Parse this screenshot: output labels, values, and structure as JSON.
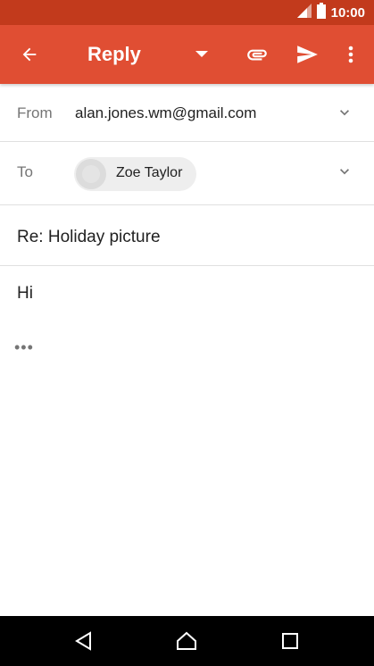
{
  "status_bar": {
    "time": "10:00",
    "icons": [
      "signal-icon",
      "battery-icon"
    ]
  },
  "app_bar": {
    "title": "Reply",
    "icons": [
      "back-arrow-icon",
      "dropdown-icon",
      "attach-icon",
      "send-icon",
      "more-vert-icon"
    ],
    "background": "#e04e33",
    "status_bar_background": "#c23a1c"
  },
  "compose": {
    "from_label": "From",
    "from_value": "alan.jones.wm@gmail.com",
    "to_label": "To",
    "recipient": "Zoe Taylor",
    "subject": "Re: Holiday picture",
    "body": "Hi",
    "quoted_toggle": "•••"
  },
  "nav_bar": {
    "icons": [
      "back-triangle-icon",
      "home-icon",
      "recents-square-icon"
    ]
  }
}
